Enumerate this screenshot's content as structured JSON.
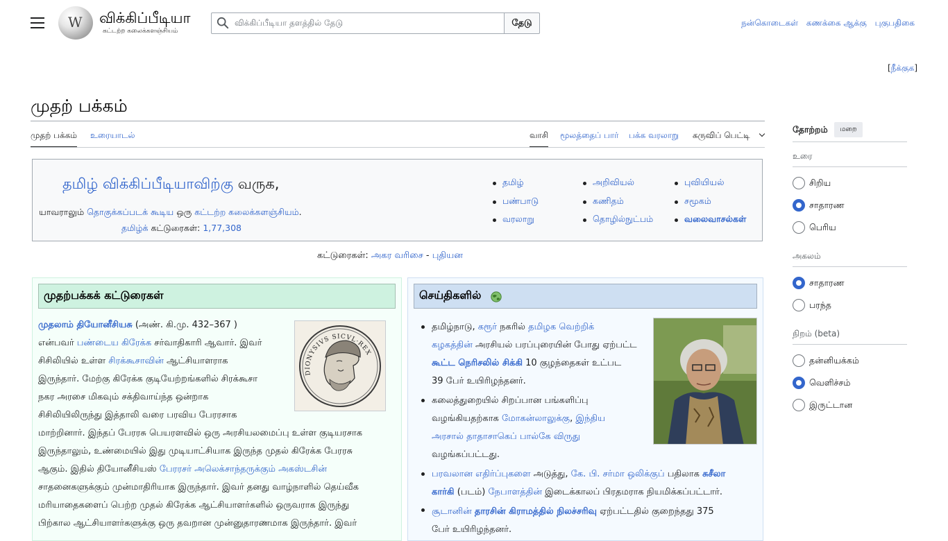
{
  "header": {
    "wordmark": "விக்கிப்பீடியா",
    "tagline": "கட்டற்ற கலைக்களஞ்சியம்",
    "search_placeholder": "விக்கிப்பீடியா தளத்தில் தேடு",
    "search_button": "தேடு",
    "links": [
      "நன்கொடைகள்",
      "கணக்கை ஆக்கு",
      "புகுபதிகை"
    ]
  },
  "hide_link": "நீக்குக",
  "page": {
    "title": "முதற் பக்கம்",
    "tabs_left": [
      "முதற் பக்கம்",
      "உரையாடல்"
    ],
    "tabs_right": [
      "வாசி",
      "மூலத்தைப் பார்",
      "பக்க வரலாறு",
      "கருவிப் பெட்டி"
    ]
  },
  "welcome": {
    "title_link": "தமிழ் விக்கிப்பீடியாவிற்கு",
    "title_rest": " வருக,",
    "sub_prefix": "யாவராலும் ",
    "sub_link1": "தொகுக்கப்படக் கூடிய",
    "sub_mid": " ஒரு ",
    "sub_link2": "கட்டற்ற கலைக்களஞ்சியம்",
    "sub_suffix": ".",
    "count_link": "தமிழ்க்",
    "count_text": " கட்டுரைகள்: ",
    "count_value": "1,77,308",
    "portals": [
      "தமிழ்",
      "பண்பாடு",
      "வரலாறு",
      "அறிவியல்",
      "கணிதம்",
      "தொழில்நுட்பம்",
      "புவியியல்",
      "சமூகம்",
      "வலைவாசல்கள்"
    ]
  },
  "article_index": {
    "label": "கட்டுரைகள்:",
    "link1": "அகர வரிசை",
    "sep": " - ",
    "link2": "புதியன"
  },
  "featured": {
    "heading": "முதற்பக்கக் கட்டுரைகள்",
    "title_link": "முதலாம் தியோனீசியசு",
    "date": " (அண். கி.மு. 432–367 )",
    "l2_a": "என்பவர் ",
    "l2_link": "பண்டைய கிரேக்க",
    "l2_b": " சர்வாதிகாரி ஆவார். இவர்",
    "l3_a": "சிசிலியில் உள்ள ",
    "l3_link": "சிரக்கூசாவின்",
    "l3_b": " ஆட்சியாளராக",
    "l4": "இருந்தார். மேற்கு கிரேக்க குடியேற்றங்களில் சிரக்கூசா",
    "l5": "நகர அரசை மிகவும் சக்திவாய்ந்த ஒன்றாக",
    "l6": "சிசிலியிலிருந்து இத்தாலி வரை பரவிய பேரரசாக",
    "l7": "மாற்றினார். இந்தப் பேரரசு பெயரளவில் ஒரு அரசியலமைப்பு உள்ள குடியரசாக",
    "l8": "இருந்தாலும், உண்மையில் இது முடியாட்சியாக இருந்த முதல் கிரேக்க பேரரசு",
    "l9": "ஆகும். இதில் தியோனீசியஸ் ",
    "l9_link": "பேரரசர் அலெக்சாந்தருக்கும் அகஸ்டசின்",
    "l10": "சாதனைகளுக்கும் முன்மாதிரியாக இருந்தார். இவர் தனது வாழ்நாளில் தெய்வீக",
    "l11": "மரியாதைகளைப் பெற்ற முதல் கிரேக்க ஆட்சியாளர்களில் ஒருவராக இருந்து",
    "l12": "பிற்கால ஆட்சியாளர்களுக்கு ஒரு தவறான முன்னுதாரணமாக இருந்தார். இவர்",
    "coin_text": "DIONYSIVS SICVL·REX"
  },
  "news": {
    "heading": "செய்திகளில்",
    "i1_a": "தமிழ்நாடு, ",
    "i1_link1": "கரூர்",
    "i1_b": " நகரில் ",
    "i1_link2": "தமிழக வெற்றிக்",
    "i1_link3": "கழகத்தின்",
    "i1_c": " அரசியல் பரப்புரையின் போது ஏற்பட்ட",
    "i1_link4": "கூட்ட நெரிசலில் சிக்கி",
    "i1_d": " 10 குழந்தைகள் உட்பட",
    "i1_e": "39 பேர் உயிரிழந்தனர்.",
    "i2_a": "கலைத்துறையில் சிறப்பான பங்களிப்பு",
    "i2_b": "வழங்கியதற்காக ",
    "i2_link1": "மோகன்லாலுக்கு",
    "i2_c": ", ",
    "i2_link2": "இந்திய",
    "i2_link3": "அரசால் தாதாசாகெப் பால்கே விருது",
    "i2_d": "வழங்கப்பட்டது.",
    "i3_link1": "பரவலான எதிர்ப்புகளை",
    "i3_a": " அடுத்து, ",
    "i3_link2": "கே. பி. சர்மா ஒலிக்குப்",
    "i3_b": " பதிலாக ",
    "i3_link3": "சுசீலா",
    "i3_link4": "கார்கி",
    "i3_c": " (படம்) ",
    "i3_link5": "நேபாளத்தின்",
    "i3_d": " இடைக்காலப் பிரதமராக நியமிக்கப்பட்டார்.",
    "i4_link1": "சூடானின்",
    "i4_a": " ",
    "i4_link2": "தாரசின் கிராமத்தில் நிலச்சரிவு",
    "i4_b": " ஏற்பட்டதில் குறைந்தது 375",
    "i4_c": "பேர் உயிரிழந்தனர்."
  },
  "appearance": {
    "title": "தோற்றம்",
    "hide": "மறை",
    "text_head": "உரை",
    "text_options": [
      "சிறிய",
      "சாதாரண",
      "பெரிய"
    ],
    "width_head": "அகலம்",
    "width_options": [
      "சாதாரண",
      "பரந்த"
    ],
    "color_head": "நிறம் (beta)",
    "color_options": [
      "தன்னியக்கம்",
      "வெளிச்சம்",
      "இருட்டான"
    ]
  },
  "colors": {
    "link": "#3366cc",
    "accent": "#3366cc",
    "featured_bg": "#f5fffa",
    "news_bg": "#f5faff"
  }
}
